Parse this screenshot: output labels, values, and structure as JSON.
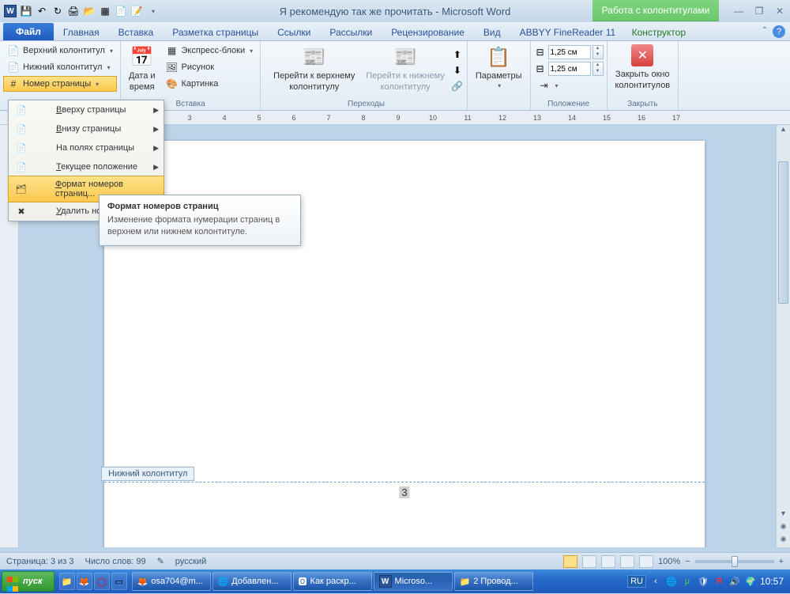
{
  "titlebar": {
    "document": "Я рекомендую так же прочитать",
    "app": "Microsoft Word",
    "separator": " - ",
    "contextual_title": "Работа с колонтитулами"
  },
  "tabs": {
    "file": "Файл",
    "home": "Главная",
    "insert": "Вставка",
    "pagelayout": "Разметка страницы",
    "references": "Ссылки",
    "mailings": "Рассылки",
    "review": "Рецензирование",
    "view": "Вид",
    "abbyy": "ABBYY FineReader 11",
    "constructor": "Конструктор"
  },
  "ribbon": {
    "header": "Верхний колонтитул",
    "footer": "Нижний колонтитул",
    "pagenumber": "Номер страницы",
    "datetime_l1": "Дата и",
    "datetime_l2": "время",
    "quickparts": "Экспресс-блоки",
    "picture": "Рисунок",
    "clipart": "Картинка",
    "group_insert": "Вставка",
    "goto_header_l1": "Перейти к верхнему",
    "goto_header_l2": "колонтитулу",
    "goto_footer_l1": "Перейти к нижнему",
    "goto_footer_l2": "колонтитулу",
    "group_navigation": "Переходы",
    "options": "Параметры",
    "pos_top": "1,25 см",
    "pos_bottom": "1,25 см",
    "group_position": "Положение",
    "close_l1": "Закрыть окно",
    "close_l2": "колонтитулов",
    "group_close": "Закрыть"
  },
  "dropdown": {
    "items": [
      {
        "label": "Вверху страницы",
        "underline": "В",
        "arrow": true,
        "icon": "📄"
      },
      {
        "label": "Внизу страницы",
        "underline": "В",
        "arrow": true,
        "icon": "📄"
      },
      {
        "label": "На полях страницы",
        "underline": "",
        "arrow": true,
        "icon": "📄"
      },
      {
        "label": "Текущее положение",
        "underline": "Т",
        "arrow": true,
        "icon": "📄"
      },
      {
        "label": "Формат номеров страниц...",
        "underline": "Ф",
        "arrow": false,
        "icon": "🗂",
        "highlighted": true
      },
      {
        "label": "Удалить номера",
        "underline": "У",
        "arrow": false,
        "icon": "✖"
      }
    ]
  },
  "tooltip": {
    "title": "Формат номеров страниц",
    "body": "Изменение формата нумерации страниц в верхнем или нижнем колонтитуле."
  },
  "document": {
    "footer_label": "Нижний колонтитул",
    "page_number_display": "3"
  },
  "statusbar": {
    "page": "Страница: 3 из 3",
    "words": "Число слов: 99",
    "language": "русский",
    "zoom": "100%"
  },
  "taskbar": {
    "start": "пуск",
    "tasks": [
      {
        "icon": "🦊",
        "label": "osa704@m..."
      },
      {
        "icon": "🌐",
        "label": "Добавлен..."
      },
      {
        "icon": "🅾",
        "label": "Как раскр..."
      },
      {
        "icon": "W",
        "label": "Microso...",
        "active": true
      },
      {
        "icon": "📁",
        "label": "2 Провод..."
      }
    ],
    "lang": "RU",
    "clock": "10:57"
  }
}
